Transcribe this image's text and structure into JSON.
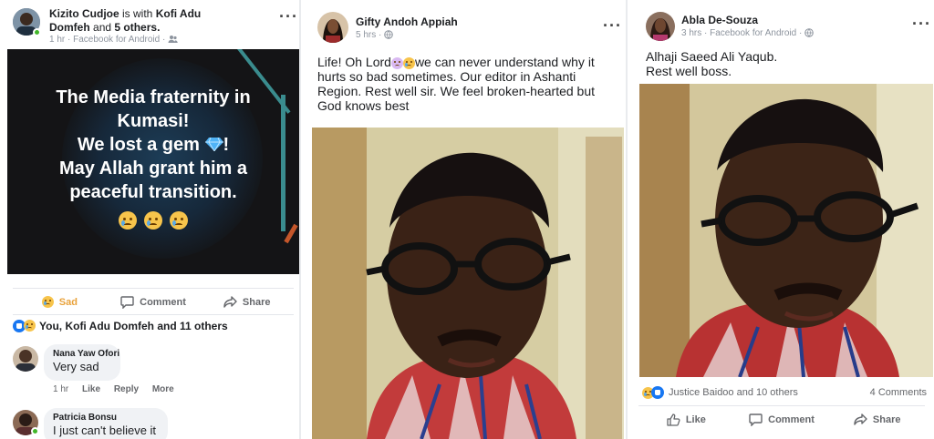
{
  "posts": [
    {
      "author": "Kizito Cudjoe",
      "with_text": "is with",
      "tagged": "Kofi Adu Domfeh",
      "and_text": "and",
      "others": "5 others.",
      "time": "1 hr",
      "via": "Facebook for Android",
      "privacy_icon": "friends-icon",
      "image_lines": [
        "The Media fraternity in",
        "Kumasi!",
        "We lost a gem",
        "!",
        "May Allah grant him a",
        "peaceful transition."
      ],
      "actions": {
        "sad": "Sad",
        "comment": "Comment",
        "share": "Share"
      },
      "reactions_summary": "You, Kofi Adu Domfeh and 11 others",
      "comments": [
        {
          "name": "Nana Yaw Ofori",
          "text": "Very sad",
          "time": "1 hr",
          "like": "Like",
          "reply": "Reply",
          "more": "More"
        },
        {
          "name": "Patricia Bonsu",
          "text": "I just can't believe it"
        }
      ]
    },
    {
      "author": "Gifty Andoh Appiah",
      "time": "5 hrs",
      "privacy_icon": "globe-icon",
      "text_part1": "Life! Oh Lord",
      "text_part2": "we can never understand why it hurts so bad sometimes. Our editor in Ashanti Region. Rest well sir. We feel broken-hearted but God knows best"
    },
    {
      "author": "Abla De-Souza",
      "time": "3 hrs",
      "via": "Facebook for Android",
      "privacy_icon": "globe-icon",
      "text": [
        "Alhaji Saeed Ali Yaqub.",
        "Rest well boss."
      ],
      "reactions_summary": "Justice Baidoo and 10 others",
      "comments_count": "4 Comments",
      "actions": {
        "like": "Like",
        "comment": "Comment",
        "share": "Share"
      }
    }
  ],
  "colors": {
    "facebook_blue": "#1877f2",
    "sad_yellow": "#e9a23b",
    "online_green": "#42b72a",
    "meta_gray": "#8d949e"
  }
}
